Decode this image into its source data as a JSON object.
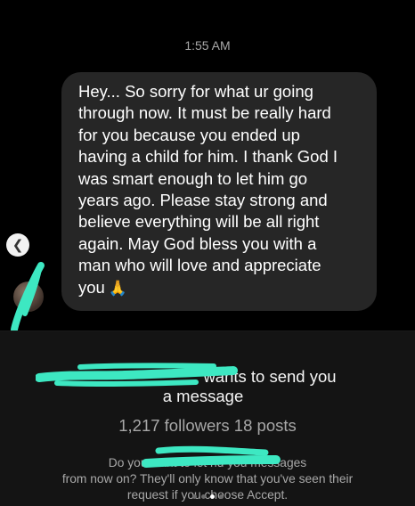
{
  "status": {
    "time": "1:55 AM"
  },
  "message": {
    "text": "Hey... So sorry for what ur going\nthrough now. It must be really hard\nfor you because you ended up\nhaving a child for him. I thank God I\nwas smart enough to let him go\nyears ago. Please stay strong and\nbelieve everything will be all right\nagain. May God bless you with a\nman who will love and appreciate\nyou",
    "emoji": "🙏",
    "emoji_icon": "praying-hands-icon"
  },
  "request": {
    "title_line1": "wants to send you",
    "title_line2": "a message",
    "stats": "1,217 followers 18 posts",
    "description": "Do you want to let                                        nd you messages\nfrom now on? They'll only know that you've seen their\nrequest if you choose Accept."
  },
  "carousel": {
    "index": 2,
    "total": 4
  },
  "colors": {
    "background": "#000000",
    "bubble": "#262626",
    "panel": "#141414",
    "secondary_text": "#a8a8a8",
    "redaction": "#3de8c2"
  }
}
